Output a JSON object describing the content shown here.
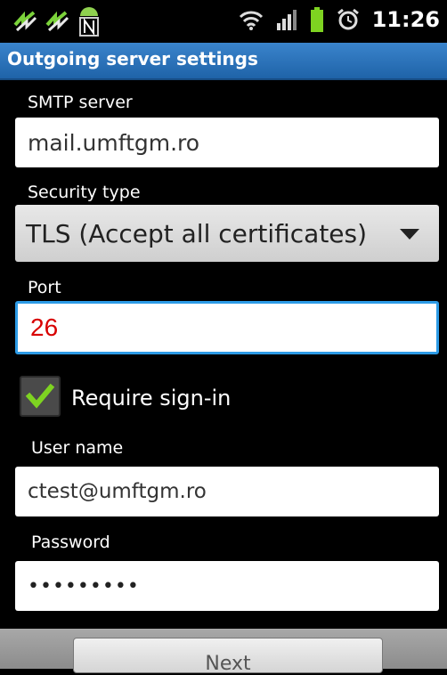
{
  "status_bar": {
    "time": "11:26"
  },
  "header": {
    "title": "Outgoing server settings"
  },
  "form": {
    "smtp_label": "SMTP server",
    "smtp_value": "mail.umftgm.ro",
    "security_label": "Security type",
    "security_value": "TLS (Accept all certificates)",
    "port_label": "Port",
    "port_value": "26",
    "require_signin_label": "Require sign-in",
    "require_signin_checked": true,
    "username_label": "User name",
    "username_value": "ctest@umftgm.ro",
    "password_label": "Password",
    "password_value": "•••••••••"
  },
  "footer": {
    "next_label": "Next"
  },
  "colors": {
    "accent": "#2d9be6",
    "title_bar": "#2a74bd",
    "port_text": "#d80000",
    "check": "#7ed321"
  }
}
